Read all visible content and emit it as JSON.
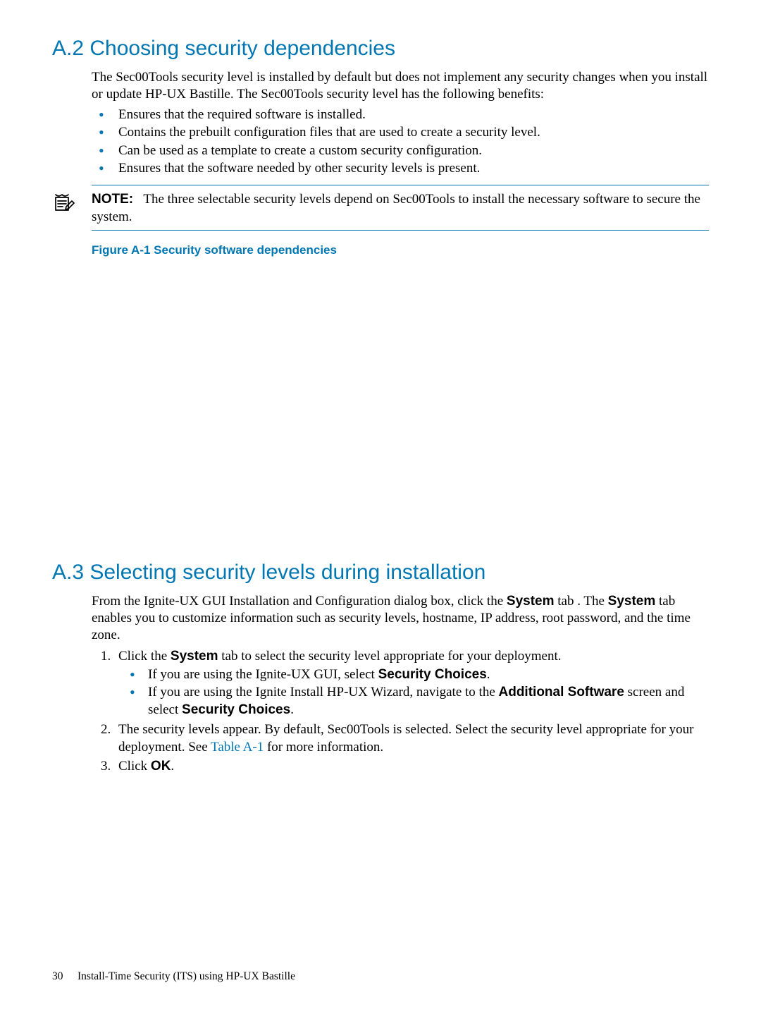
{
  "headings": {
    "a2": "A.2 Choosing security dependencies",
    "a3": "A.3 Selecting security levels during installation"
  },
  "a2": {
    "intro": "The Sec00Tools security level is installed by default but does not implement any security changes when you install or update HP-UX Bastille. The Sec00Tools security level has the following benefits:",
    "bullets": [
      "Ensures that the required software is installed.",
      "Contains the prebuilt configuration files that are used to create a security level.",
      "Can be used as a template to create a custom security configuration.",
      "Ensures that the software needed by other security levels is present."
    ],
    "note_label": "NOTE:",
    "note_text": "The three selectable security levels depend on Sec00Tools to install the necessary software to secure the system.",
    "figure_caption": "Figure A-1 Security software dependencies"
  },
  "a3": {
    "intro_parts": {
      "p1": "From the Ignite-UX GUI Installation and Configuration dialog box, click the ",
      "system1": "System",
      "p2": " tab . The ",
      "system2": "System",
      "p3": " tab enables you to customize information such as security levels, hostname, IP address, root password, and the time zone."
    },
    "step1": {
      "prefix": "Click the ",
      "bold": "System",
      "suffix": " tab to select the security level appropriate for your deployment."
    },
    "step1_sub": [
      {
        "prefix": "If you are using the Ignite-UX GUI, select ",
        "bold": "Security Choices",
        "suffix": "."
      },
      {
        "prefix": "If you are using the Ignite Install HP-UX Wizard, navigate to the ",
        "bold": "Additional Software",
        "suffix_plain": " screen and select ",
        "bold2": "Security Choices",
        "suffix2": "."
      }
    ],
    "step2": {
      "prefix": "The security levels appear. By default, Sec00Tools is selected. Select the security level appropriate for your deployment. See ",
      "link": "Table A-1",
      "suffix": " for more information."
    },
    "step3": {
      "prefix": "Click ",
      "bold": "OK",
      "suffix": "."
    }
  },
  "footer": {
    "page_number": "30",
    "title": "Install-Time Security (ITS) using HP-UX Bastille"
  }
}
